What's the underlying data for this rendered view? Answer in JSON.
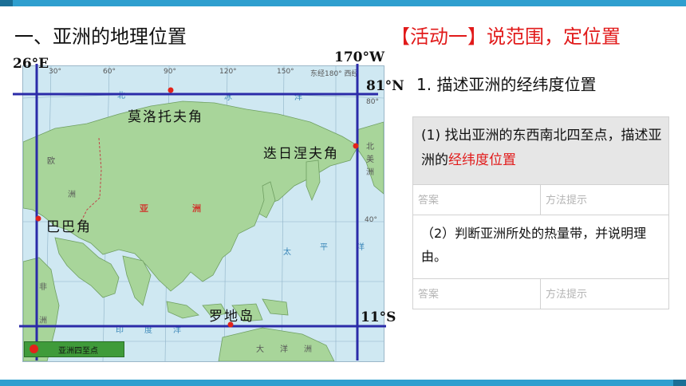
{
  "header": {
    "section_title": "一、亚洲的地理位置",
    "activity_title": "【活动一】说范围，定位置"
  },
  "map": {
    "coords": {
      "west": "26°E",
      "east": "170°W",
      "north": "81°N",
      "south": "11°S"
    },
    "grid_labels": {
      "lon_30": "30°",
      "lon_60": "60°",
      "lon_90": "90°",
      "lon_120": "120°",
      "lon_150": "150°",
      "lon_180": "东经180° 西经",
      "lat_80": "80°",
      "lat_40": "40°"
    },
    "points": {
      "north": "莫洛托夫角",
      "east": "迭日涅夫角",
      "west": "巴巴角",
      "south": "罗地岛"
    },
    "region_labels": {
      "arctic_1": "北",
      "arctic_2": "冰",
      "arctic_3": "洋",
      "europe_1": "欧",
      "europe_2": "洲",
      "africa_1": "非",
      "africa_2": "洲",
      "asia_1": "亚",
      "asia_2": "洲",
      "na_1": "北",
      "na_2": "美",
      "na_3": "洲",
      "pacific_1": "太",
      "pacific_2": "平",
      "pacific_3": "洋",
      "indian_1": "印",
      "indian_2": "度",
      "indian_3": "洋",
      "oceania_1": "大",
      "oceania_2": "洋",
      "oceania_3": "洲"
    },
    "legend": "亚洲四至点",
    "colors": {
      "ocean": "#cfe8f2",
      "land": "#a8d59a",
      "extreme_line": "#2b2ba8",
      "point": "#e2231a"
    }
  },
  "task": {
    "title": "1. 描述亚洲的经纬度位置",
    "q1_text": "(1) 找出亚洲的东西南北四至点，描述亚洲的",
    "q1_highlight": "经纬度位置",
    "q2_text": "（2）判断亚洲所处的热量带，并说明理由。",
    "answer_label": "答案",
    "hint_label": "方法提示"
  }
}
